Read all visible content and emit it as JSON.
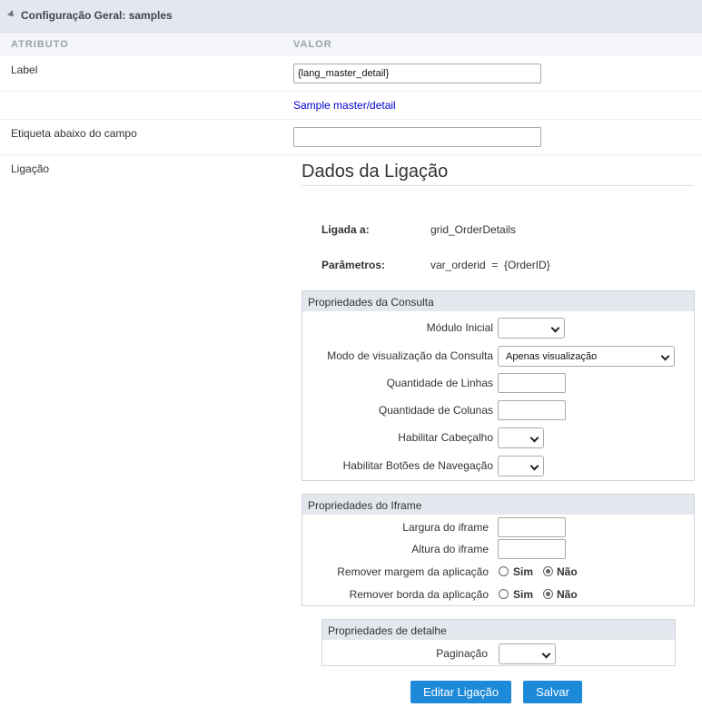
{
  "header": {
    "title": "Configuração Geral: samples"
  },
  "columns": {
    "attribute": "ATRIBUTO",
    "value": "VALOR"
  },
  "fields": {
    "label": {
      "name": "Label",
      "value": "{lang_master_detail}",
      "preview": "Sample master/detail"
    },
    "etiqueta": {
      "name": "Etiqueta abaixo do campo",
      "value": ""
    },
    "ligacao": {
      "name": "Ligação"
    }
  },
  "dados": {
    "title": "Dados da Ligação",
    "ligada_label": "Ligada a:",
    "ligada_value": "grid_OrderDetails",
    "params_label": "Parâmetros:",
    "params_value": "var_orderid  =  {OrderID}"
  },
  "consulta": {
    "title": "Propriedades da Consulta",
    "modulo_inicial": "Módulo Inicial",
    "modo_visualizacao": "Modo de visualização da Consulta",
    "modo_value": "Apenas visualização",
    "qtd_linhas": "Quantidade de Linhas",
    "qtd_colunas": "Quantidade de Colunas",
    "cabecalho": "Habilitar Cabeçalho",
    "botoes_nav": "Habilitar Botões de Navegação"
  },
  "iframe": {
    "title": "Propriedades do Iframe",
    "largura": "Largura do iframe",
    "altura": "Altura do iframe",
    "remover_margem": "Remover margem da aplicação",
    "remover_borda": "Remover borda da aplicação",
    "sim": "Sim",
    "nao": "Não"
  },
  "detalhe": {
    "title": "Propriedades de detalhe",
    "paginacao": "Paginação"
  },
  "buttons": {
    "editar": "Editar Ligação",
    "salvar": "Salvar"
  }
}
